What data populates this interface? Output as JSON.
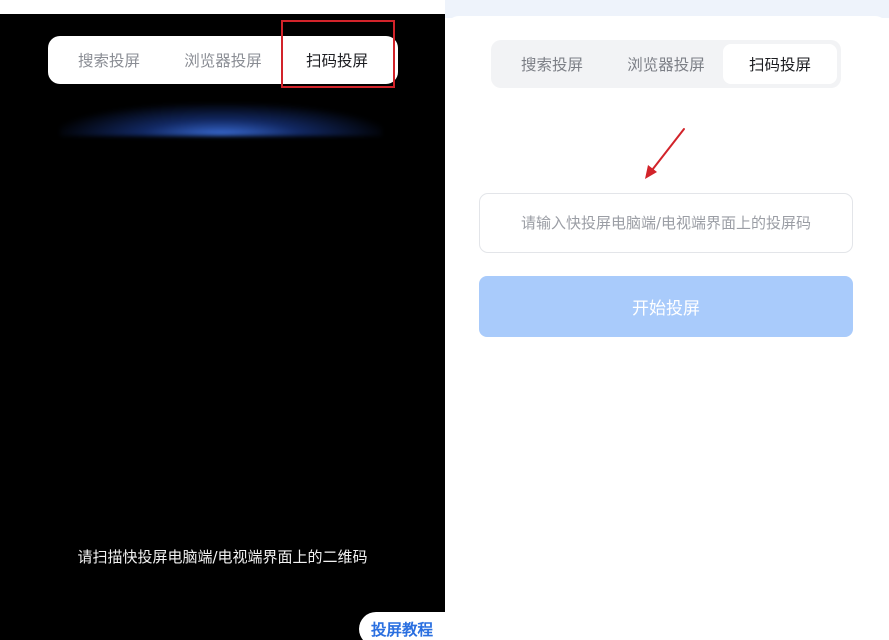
{
  "left_panel": {
    "tabs": [
      {
        "label": "搜索投屏",
        "active": false
      },
      {
        "label": "浏览器投屏",
        "active": false
      },
      {
        "label": "扫码投屏",
        "active": true
      }
    ],
    "scan_hint": "请扫描快投屏电脑端/电视端界面上的二维码",
    "tutorial_label": "投屏教程"
  },
  "right_panel": {
    "tabs": [
      {
        "label": "搜索投屏",
        "active": false
      },
      {
        "label": "浏览器投屏",
        "active": false
      },
      {
        "label": "扫码投屏",
        "active": true
      }
    ],
    "code_input": {
      "value": "",
      "placeholder": "请输入快投屏电脑端/电视端界面上的投屏码"
    },
    "start_button_label": "开始投屏"
  },
  "colors": {
    "annotation_red": "#d2232a",
    "primary_blue": "#2a6fe0",
    "button_disabled_blue": "#a9cbfb",
    "scan_glow": "#4682ff"
  }
}
